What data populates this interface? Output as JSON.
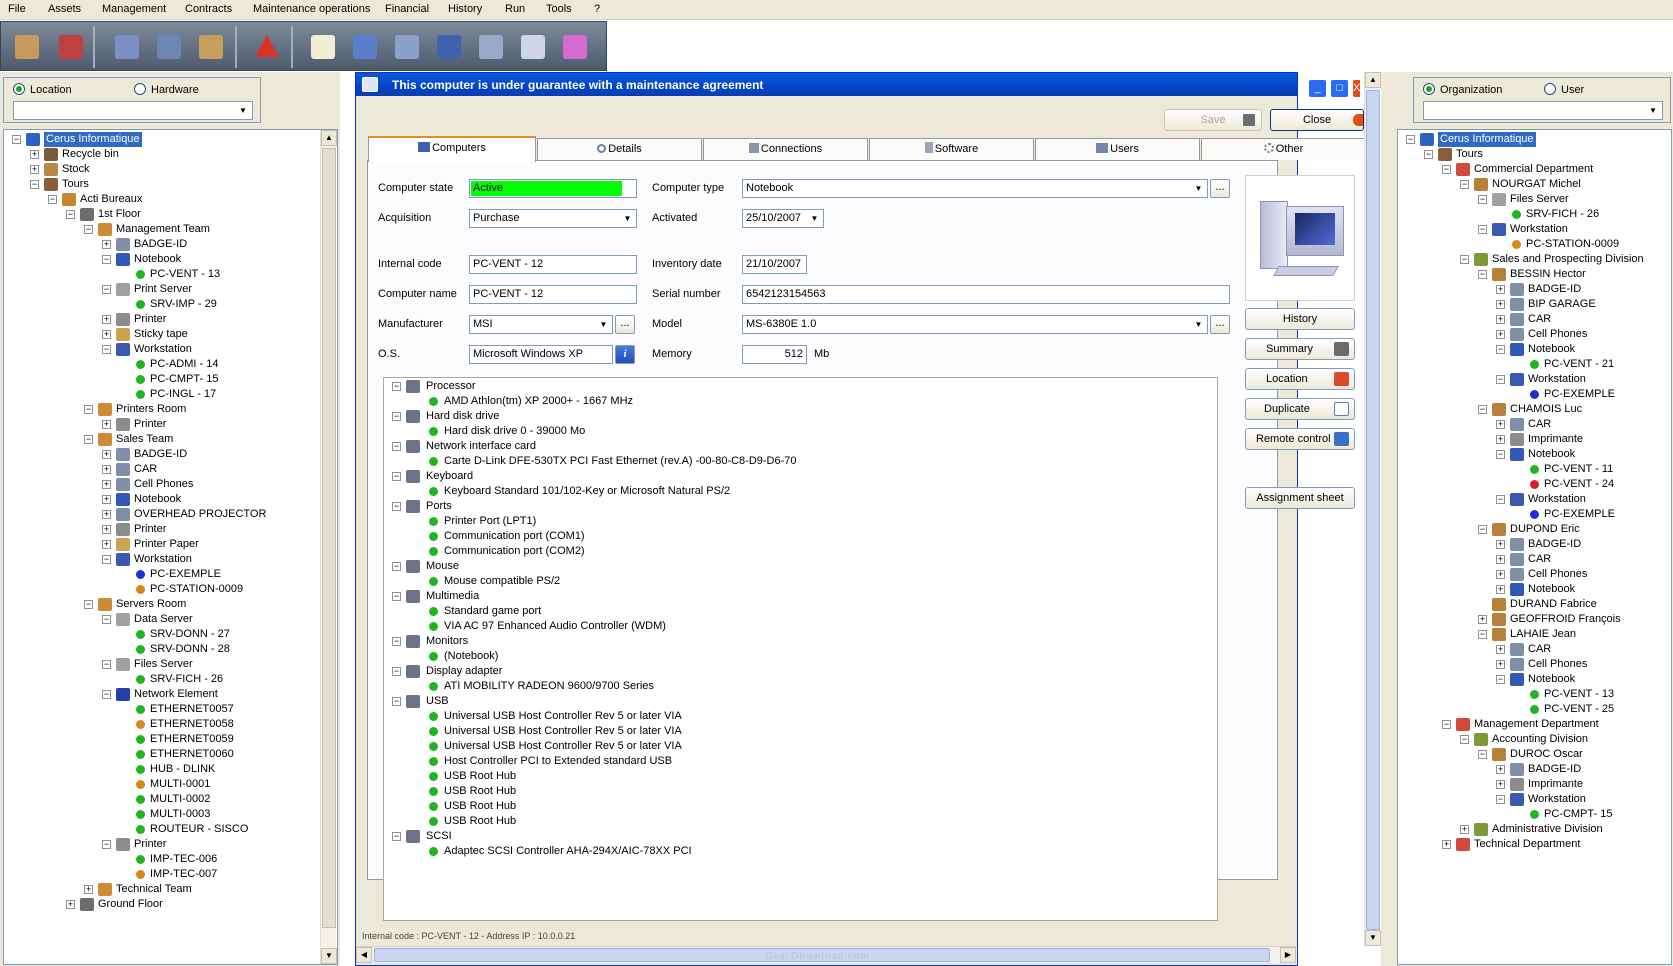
{
  "menu": [
    "File",
    "Assets",
    "Management",
    "Contracts",
    "Maintenance operations",
    "Financial",
    "History",
    "Run",
    "Tools",
    "?"
  ],
  "toolbar_icons": [
    "locations-icon",
    "hierarchy-icon",
    "contact-card-icon",
    "user-icon",
    "user-gold-icon",
    "alert-icon",
    "new-document-icon",
    "computer-icon",
    "printer-icon",
    "network-icon",
    "scanner-icon",
    "storage-icon",
    "color-palette-icon"
  ],
  "left_panel": {
    "radio_location": "Location",
    "radio_hardware": "Hardware",
    "selected": "location",
    "tree": [
      {
        "l": 0,
        "t": "Cerus Informatique",
        "i": "globe",
        "e": "-",
        "s": true
      },
      {
        "l": 1,
        "t": "Recycle bin",
        "i": "bin",
        "e": "+"
      },
      {
        "l": 1,
        "t": "Stock",
        "i": "box",
        "e": "+"
      },
      {
        "l": 1,
        "t": "Tours",
        "i": "building",
        "e": "-"
      },
      {
        "l": 2,
        "t": "Acti  Bureaux",
        "i": "house",
        "e": "-"
      },
      {
        "l": 3,
        "t": "1st Floor",
        "i": "stairs",
        "e": "-"
      },
      {
        "l": 4,
        "t": "Management Team",
        "i": "team",
        "e": "-"
      },
      {
        "l": 5,
        "t": "BADGE-ID",
        "i": "device",
        "e": "+"
      },
      {
        "l": 5,
        "t": "Notebook",
        "i": "notebook",
        "e": "-"
      },
      {
        "l": 6,
        "t": "PC-VENT - 13",
        "i": "green"
      },
      {
        "l": 5,
        "t": "Print Server",
        "i": "server",
        "e": "-"
      },
      {
        "l": 6,
        "t": "SRV-IMP - 29",
        "i": "green"
      },
      {
        "l": 5,
        "t": "Printer",
        "i": "printer",
        "e": "+"
      },
      {
        "l": 5,
        "t": "Sticky tape",
        "i": "tape",
        "e": "+"
      },
      {
        "l": 5,
        "t": "Workstation",
        "i": "workstation",
        "e": "-"
      },
      {
        "l": 6,
        "t": "PC-ADMI - 14",
        "i": "green"
      },
      {
        "l": 6,
        "t": "PC-CMPT- 15",
        "i": "green"
      },
      {
        "l": 6,
        "t": "PC-INGL - 17",
        "i": "green"
      },
      {
        "l": 4,
        "t": "Printers Room",
        "i": "team",
        "e": "-"
      },
      {
        "l": 5,
        "t": "Printer",
        "i": "printer",
        "e": "+"
      },
      {
        "l": 4,
        "t": "Sales Team",
        "i": "team",
        "e": "-"
      },
      {
        "l": 5,
        "t": "BADGE-ID",
        "i": "device",
        "e": "+"
      },
      {
        "l": 5,
        "t": "CAR",
        "i": "device",
        "e": "+"
      },
      {
        "l": 5,
        "t": "Cell Phones",
        "i": "device",
        "e": "+"
      },
      {
        "l": 5,
        "t": "Notebook",
        "i": "notebook",
        "e": "+"
      },
      {
        "l": 5,
        "t": "OVERHEAD PROJECTOR",
        "i": "device",
        "e": "+"
      },
      {
        "l": 5,
        "t": "Printer",
        "i": "printer",
        "e": "+"
      },
      {
        "l": 5,
        "t": "Printer Paper",
        "i": "tape",
        "e": "+"
      },
      {
        "l": 5,
        "t": "Workstation",
        "i": "workstation",
        "e": "-"
      },
      {
        "l": 6,
        "t": "PC-EXEMPLE",
        "i": "blue"
      },
      {
        "l": 6,
        "t": "PC-STATION-0009",
        "i": "orange"
      },
      {
        "l": 4,
        "t": "Servers Room",
        "i": "team",
        "e": "-"
      },
      {
        "l": 5,
        "t": "Data Server",
        "i": "server",
        "e": "-"
      },
      {
        "l": 6,
        "t": "SRV-DONN - 27",
        "i": "green"
      },
      {
        "l": 6,
        "t": "SRV-DONN - 28",
        "i": "green"
      },
      {
        "l": 5,
        "t": "Files Server",
        "i": "server",
        "e": "-"
      },
      {
        "l": 6,
        "t": "SRV-FICH - 26",
        "i": "green"
      },
      {
        "l": 5,
        "t": "Network Element",
        "i": "network",
        "e": "-"
      },
      {
        "l": 6,
        "t": "ETHERNET0057",
        "i": "green"
      },
      {
        "l": 6,
        "t": "ETHERNET0058",
        "i": "orange"
      },
      {
        "l": 6,
        "t": "ETHERNET0059",
        "i": "green"
      },
      {
        "l": 6,
        "t": "ETHERNET0060",
        "i": "green"
      },
      {
        "l": 6,
        "t": "HUB - DLINK",
        "i": "green"
      },
      {
        "l": 6,
        "t": "MULTI-0001",
        "i": "orange"
      },
      {
        "l": 6,
        "t": "MULTI-0002",
        "i": "green"
      },
      {
        "l": 6,
        "t": "MULTI-0003",
        "i": "green"
      },
      {
        "l": 6,
        "t": "ROUTEUR - SISCO",
        "i": "green"
      },
      {
        "l": 5,
        "t": "Printer",
        "i": "printer",
        "e": "-"
      },
      {
        "l": 6,
        "t": "IMP-TEC-006",
        "i": "green"
      },
      {
        "l": 6,
        "t": "IMP-TEC-007",
        "i": "orange"
      },
      {
        "l": 4,
        "t": "Technical Team",
        "i": "team",
        "e": "+"
      },
      {
        "l": 3,
        "t": "Ground Floor",
        "i": "stairs",
        "e": "+"
      }
    ]
  },
  "right_panel": {
    "radio_organization": "Organization",
    "radio_user": "User",
    "selected": "organization",
    "tree": [
      {
        "l": 0,
        "t": "Cerus Informatique",
        "i": "globe",
        "e": "-",
        "s": true
      },
      {
        "l": 1,
        "t": "Tours",
        "i": "building",
        "e": "-"
      },
      {
        "l": 2,
        "t": "Commercial Department",
        "i": "dept",
        "e": "-"
      },
      {
        "l": 3,
        "t": "NOURGAT Michel",
        "i": "person",
        "e": "-"
      },
      {
        "l": 4,
        "t": "Files Server",
        "i": "server",
        "e": "-"
      },
      {
        "l": 5,
        "t": "SRV-FICH - 26",
        "i": "green"
      },
      {
        "l": 4,
        "t": "Workstation",
        "i": "workstation",
        "e": "-"
      },
      {
        "l": 5,
        "t": "PC-STATION-0009",
        "i": "orange"
      },
      {
        "l": 3,
        "t": "Sales and Prospecting Division",
        "i": "division",
        "e": "-"
      },
      {
        "l": 4,
        "t": "BESSIN Hector",
        "i": "person",
        "e": "-"
      },
      {
        "l": 5,
        "t": "BADGE-ID",
        "i": "device",
        "e": "+"
      },
      {
        "l": 5,
        "t": "BIP GARAGE",
        "i": "device",
        "e": "+"
      },
      {
        "l": 5,
        "t": "CAR",
        "i": "device",
        "e": "+"
      },
      {
        "l": 5,
        "t": "Cell Phones",
        "i": "device",
        "e": "+"
      },
      {
        "l": 5,
        "t": "Notebook",
        "i": "notebook",
        "e": "-"
      },
      {
        "l": 6,
        "t": "PC-VENT - 21",
        "i": "green"
      },
      {
        "l": 5,
        "t": "Workstation",
        "i": "workstation",
        "e": "-"
      },
      {
        "l": 6,
        "t": "PC-EXEMPLE",
        "i": "blue"
      },
      {
        "l": 4,
        "t": "CHAMOIS Luc",
        "i": "person",
        "e": "-"
      },
      {
        "l": 5,
        "t": "CAR",
        "i": "device",
        "e": "+"
      },
      {
        "l": 5,
        "t": "Imprimante",
        "i": "printer",
        "e": "+"
      },
      {
        "l": 5,
        "t": "Notebook",
        "i": "notebook",
        "e": "-"
      },
      {
        "l": 6,
        "t": "PC-VENT - 11",
        "i": "green"
      },
      {
        "l": 6,
        "t": "PC-VENT - 24",
        "i": "red"
      },
      {
        "l": 5,
        "t": "Workstation",
        "i": "workstation",
        "e": "-"
      },
      {
        "l": 6,
        "t": "PC-EXEMPLE",
        "i": "blue"
      },
      {
        "l": 4,
        "t": "DUPOND Eric",
        "i": "person",
        "e": "-"
      },
      {
        "l": 5,
        "t": "BADGE-ID",
        "i": "device",
        "e": "+"
      },
      {
        "l": 5,
        "t": "CAR",
        "i": "device",
        "e": "+"
      },
      {
        "l": 5,
        "t": "Cell Phones",
        "i": "device",
        "e": "+"
      },
      {
        "l": 5,
        "t": "Notebook",
        "i": "notebook",
        "e": "+"
      },
      {
        "l": 4,
        "t": "DURAND Fabrice",
        "i": "person"
      },
      {
        "l": 4,
        "t": "GEOFFROID François",
        "i": "person",
        "e": "+"
      },
      {
        "l": 4,
        "t": "LAHAIE Jean",
        "i": "person",
        "e": "-"
      },
      {
        "l": 5,
        "t": "CAR",
        "i": "device",
        "e": "+"
      },
      {
        "l": 5,
        "t": "Cell Phones",
        "i": "device",
        "e": "+"
      },
      {
        "l": 5,
        "t": "Notebook",
        "i": "notebook",
        "e": "-"
      },
      {
        "l": 6,
        "t": "PC-VENT - 13",
        "i": "green"
      },
      {
        "l": 6,
        "t": "PC-VENT - 25",
        "i": "green"
      },
      {
        "l": 2,
        "t": "Management Department",
        "i": "dept",
        "e": "-"
      },
      {
        "l": 3,
        "t": "Accounting Division",
        "i": "division",
        "e": "-"
      },
      {
        "l": 4,
        "t": "DUROC Oscar",
        "i": "person",
        "e": "-"
      },
      {
        "l": 5,
        "t": "BADGE-ID",
        "i": "device",
        "e": "+"
      },
      {
        "l": 5,
        "t": "Imprimante",
        "i": "printer",
        "e": "+"
      },
      {
        "l": 5,
        "t": "Workstation",
        "i": "workstation",
        "e": "-"
      },
      {
        "l": 6,
        "t": "PC-CMPT- 15",
        "i": "green"
      },
      {
        "l": 3,
        "t": "Administrative Division",
        "i": "division",
        "e": "+"
      },
      {
        "l": 2,
        "t": "Technical Department",
        "i": "dept",
        "e": "+"
      }
    ]
  },
  "window": {
    "title": "This computer is under guarantee with a maintenance agreement",
    "save_label": "Save",
    "close_label": "Close",
    "tabs": [
      "Computers",
      "Details",
      "Connections",
      "Software",
      "Users",
      "Other"
    ],
    "active_tab": "Computers",
    "fields": {
      "computer_state_label": "Computer state",
      "computer_state": "Active",
      "acquisition_label": "Acquisition",
      "acquisition": "Purchase",
      "internal_code_label": "Internal code",
      "internal_code": "PC-VENT - 12",
      "computer_name_label": "Computer name",
      "computer_name": "PC-VENT - 12",
      "manufacturer_label": "Manufacturer",
      "manufacturer": "MSI",
      "os_label": "O.S.",
      "os": "Microsoft Windows XP",
      "computer_type_label": "Computer type",
      "computer_type": "Notebook",
      "activated_label": "Activated",
      "activated": "25/10/2007",
      "inventory_date_label": "Inventory date",
      "inventory_date": "21/10/2007",
      "serial_number_label": "Serial number",
      "serial_number": "6542123154563",
      "model_label": "Model",
      "model": "MS-6380E 1.0",
      "memory_label": "Memory",
      "memory": "512",
      "memory_unit": "Mb"
    },
    "side_buttons": [
      "History",
      "Summary",
      "Location",
      "Duplicate",
      "Remote control",
      "Assignment sheet"
    ],
    "status_text": "Internal code : PC-VENT - 12 - Address IP : 10.0.0.21",
    "hardware_tree": [
      {
        "cat": "Processor",
        "icon": "processor-icon",
        "items": [
          "AMD Athlon(tm) XP 2000+ - 1667 MHz"
        ]
      },
      {
        "cat": "Hard disk drive",
        "icon": "hard-disk-icon",
        "items": [
          "Hard disk drive 0 - 39000 Mo"
        ]
      },
      {
        "cat": "Network interface card",
        "icon": "network-card-icon",
        "items": [
          "Carte D-Link DFE-530TX PCI Fast Ethernet (rev.A) -00-80-C8-D9-D6-70"
        ]
      },
      {
        "cat": "Keyboard",
        "icon": "keyboard-icon",
        "items": [
          "Keyboard Standard 101/102-Key or Microsoft Natural PS/2"
        ]
      },
      {
        "cat": "Ports",
        "icon": "ports-icon",
        "items": [
          "Printer Port (LPT1)",
          "Communication port (COM1)",
          "Communication port (COM2)"
        ]
      },
      {
        "cat": "Mouse",
        "icon": "mouse-icon",
        "items": [
          "Mouse compatible PS/2"
        ]
      },
      {
        "cat": "Multimedia",
        "icon": "multimedia-icon",
        "items": [
          "Standard game port",
          "VIA AC 97 Enhanced Audio Controller (WDM)"
        ]
      },
      {
        "cat": "Monitors",
        "icon": "monitor-icon",
        "items": [
          "(Notebook)"
        ]
      },
      {
        "cat": "Display adapter",
        "icon": "display-adapter-icon",
        "items": [
          "ATI MOBILITY RADEON 9600/9700 Series"
        ]
      },
      {
        "cat": "USB",
        "icon": "usb-icon",
        "items": [
          "Universal USB Host Controller Rev 5 or later VIA",
          "Universal USB Host Controller Rev 5 or later VIA",
          "Universal USB Host Controller Rev 5 or later VIA",
          "Host Controller PCI to Extended standard USB",
          "USB Root Hub",
          "USB Root Hub",
          "USB Root Hub",
          "USB Root Hub"
        ]
      },
      {
        "cat": "SCSI",
        "icon": "scsi-icon",
        "items": [
          "Adaptec SCSI Controller AHA-294X/AIC-78XX PCI"
        ]
      }
    ]
  },
  "watermark": "GearDownload.com",
  "colors": {
    "state_active": "#00ff00",
    "led_green": "#1fb51f",
    "led_orange": "#d9861a",
    "led_blue": "#1d2fd6",
    "led_red": "#d81e1e",
    "selection": "#316ac5",
    "title_bar": "#0245c5"
  }
}
